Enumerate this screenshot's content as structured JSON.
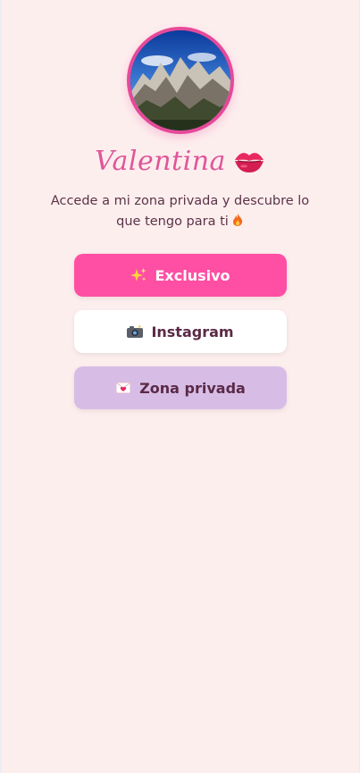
{
  "profile": {
    "avatar_icon": "mountain-landscape-photo",
    "name": "Valentina",
    "name_icon": "kiss-lips-icon",
    "bio": "Accede a mi zona privada y descubre lo que tengo para ti",
    "bio_icon": "fire-icon"
  },
  "links": [
    {
      "label": "Exclusivo",
      "icon": "sparkles-icon",
      "color": "#ff4fa4"
    },
    {
      "label": "Instagram",
      "icon": "camera-flash-icon",
      "color": "#ffffff"
    },
    {
      "label": "Zona privada",
      "icon": "love-letter-icon",
      "color": "#d7bde6"
    }
  ],
  "theme": {
    "background": "#fdeeee",
    "accent": "#e6499a",
    "text": "#5a3348"
  }
}
